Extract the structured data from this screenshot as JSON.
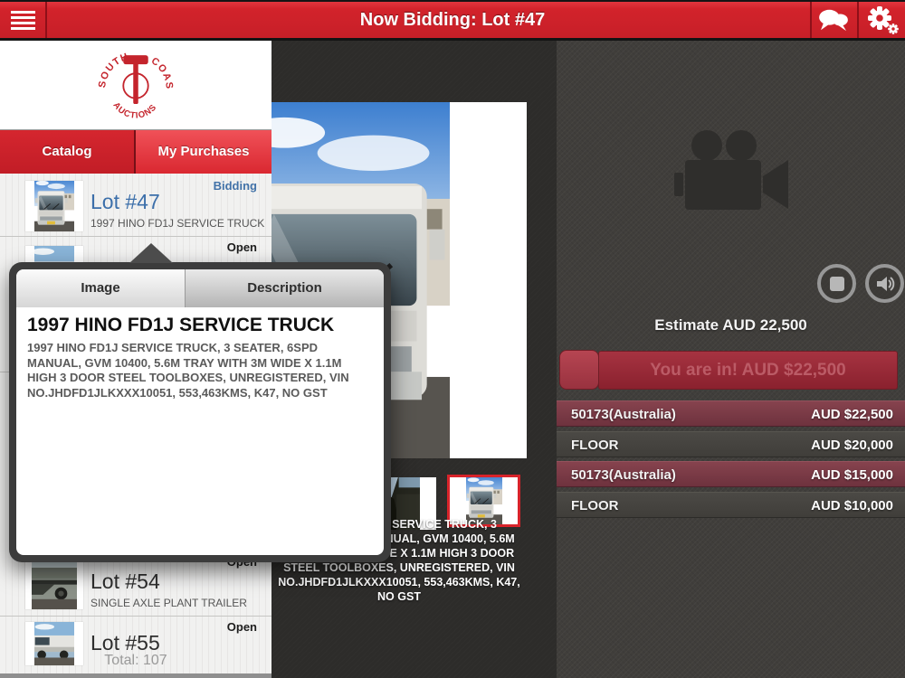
{
  "colors": {
    "topbar_red": "#d2232b",
    "catalog_tab_red": "#c11d26",
    "purchases_tab_red": "#e8434c",
    "bidding_status_blue": "#4272a8",
    "lot_number_blue": "#3c6faa",
    "bid_highlight_maroon": "#7d3943",
    "bid_button_red": "#98222e",
    "selected_thumb_border_red": "#d8232a"
  },
  "topbar": {
    "title": "Now Bidding: Lot #47"
  },
  "logo": {
    "top_left": "SOUTH",
    "top_right": "COAST",
    "bottom": "AUCTIONS"
  },
  "sidebar": {
    "tabs": {
      "catalog": "Catalog",
      "purchases": "My Purchases"
    },
    "lots": [
      {
        "number": "Lot #47",
        "desc": "1997 HINO FD1J SERVICE TRUCK",
        "status": "Bidding"
      },
      {
        "number": "",
        "desc": "",
        "status": "Open"
      },
      {
        "number": "Lot #54",
        "desc": "SINGLE AXLE PLANT TRAILER",
        "status": "Open"
      },
      {
        "number": "Lot #55",
        "desc": "",
        "status": "Open"
      }
    ],
    "total": "Total: 107"
  },
  "popover": {
    "tab_image": "Image",
    "tab_description": "Description",
    "title": "1997 HINO FD1J SERVICE TRUCK",
    "body": "1997 HINO FD1J SERVICE TRUCK, 3 SEATER, 6SPD MANUAL, GVM 10400, 5.6M TRAY WITH 3M WIDE X 1.1M HIGH 3 DOOR STEEL TOOLBOXES, UNREGISTERED, VIN NO.JHDFD1JLKXXX10051, 553,463KMS, K47, NO GST"
  },
  "main": {
    "caption": "1997 HINO FD1J SERVICE TRUCK, 3 SEATER, 6SPD MANUAL, GVM 10400, 5.6M TRAY WITH 3M WIDE X 1.1M HIGH 3 DOOR STEEL TOOLBOXES, UNREGISTERED, VIN NO.JHDFD1JLKXXX10051, 553,463KMS, K47, NO GST"
  },
  "bidding": {
    "estimate": "Estimate AUD 22,500",
    "you_are_in": "You are in! AUD $22,500",
    "history": [
      {
        "bidder": "50173(Australia)",
        "amount": "AUD $22,500",
        "highlight": true
      },
      {
        "bidder": "FLOOR",
        "amount": "AUD $20,000",
        "highlight": false
      },
      {
        "bidder": "50173(Australia)",
        "amount": "AUD $15,000",
        "highlight": true
      },
      {
        "bidder": "FLOOR",
        "amount": "AUD $10,000",
        "highlight": false
      }
    ]
  }
}
